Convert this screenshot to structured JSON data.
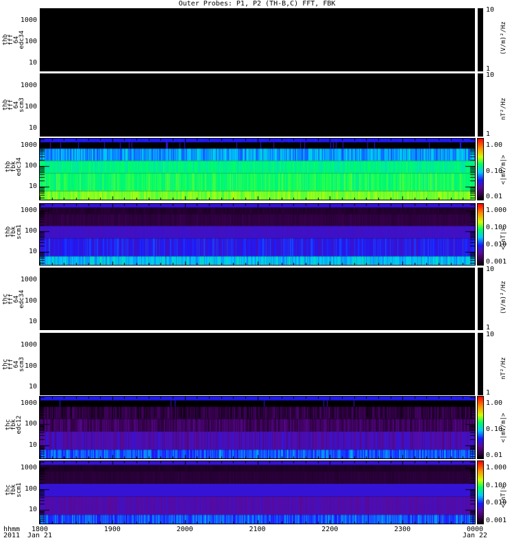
{
  "title": "Outer Probes: P1, P2 (TH-B,C) FFT, FBK",
  "x_axis": {
    "left_label_lines": [
      "hhmm",
      "2011"
    ],
    "ticks": [
      {
        "label": "1800",
        "sub": "Jan 21",
        "hour": 0
      },
      {
        "label": "1900",
        "sub": "",
        "hour": 1
      },
      {
        "label": "2000",
        "sub": "",
        "hour": 2
      },
      {
        "label": "2100",
        "sub": "",
        "hour": 3
      },
      {
        "label": "2200",
        "sub": "",
        "hour": 4
      },
      {
        "label": "2300",
        "sub": "",
        "hour": 5
      },
      {
        "label": "0000",
        "sub": "Jan 22",
        "hour": 6
      }
    ]
  },
  "chart_data": [
    {
      "type": "heatmap",
      "label": "thb\nfff\n64\nedc34",
      "kind": "fff",
      "ylim": [
        4,
        4000
      ],
      "yticks": [
        "10",
        "100",
        "1000"
      ],
      "cbar_ticks": [
        "10",
        "1"
      ],
      "cbar_unit": "(V/m)²/Hz",
      "bands": []
    },
    {
      "type": "heatmap",
      "label": "thb\nfff\n64\nscm3",
      "kind": "fff",
      "ylim": [
        4,
        4000
      ],
      "yticks": [
        "10",
        "100",
        "1000"
      ],
      "cbar_ticks": [
        "10",
        "1"
      ],
      "cbar_unit": "nT²/Hz",
      "bands": []
    },
    {
      "type": "heatmap",
      "label": "thb\nfbk\nedc34",
      "kind": "fbk",
      "ylim": [
        2.3,
        2150
      ],
      "yticks": [
        "10",
        "100",
        "1000"
      ],
      "cbar_ticks": [
        "1.00",
        "0.10",
        "0.01"
      ],
      "cbar_unit": "<|mV/m|>",
      "seed": 3,
      "bands": [
        {
          "f": [
            1400,
            2150
          ],
          "level": 0.31,
          "var": 0.02
        },
        {
          "f": [
            700,
            1400
          ],
          "level": 0.0,
          "var": 0.0,
          "spikes": 0.03
        },
        {
          "f": [
            180,
            700
          ],
          "level": 0.42,
          "var": 0.07
        },
        {
          "f": [
            45,
            180
          ],
          "level": 0.55,
          "var": 0.04
        },
        {
          "f": [
            6,
            45
          ],
          "level": 0.58,
          "var": 0.05
        },
        {
          "f": [
            2.3,
            6
          ],
          "level": 0.65,
          "var": 0.04
        }
      ]
    },
    {
      "type": "heatmap",
      "label": "thb\nfbk\nscm1",
      "kind": "fbk",
      "ylim": [
        2.3,
        2150
      ],
      "yticks": [
        "10",
        "100",
        "1000"
      ],
      "cbar_ticks": [
        "1.000",
        "0.100",
        "0.010",
        "0.001"
      ],
      "cbar_unit": "<|nT|>",
      "seed": 7,
      "bands": [
        {
          "f": [
            1400,
            2150
          ],
          "level": 0.27,
          "var": 0.0
        },
        {
          "f": [
            700,
            1400
          ],
          "level": 0.06,
          "var": 0.015
        },
        {
          "f": [
            180,
            700
          ],
          "level": 0.08,
          "var": 0.015
        },
        {
          "f": [
            45,
            180
          ],
          "level": 0.25,
          "var": 0.01
        },
        {
          "f": [
            6,
            45
          ],
          "level": 0.3,
          "var": 0.06
        },
        {
          "f": [
            2.3,
            6
          ],
          "level": 0.45,
          "var": 0.06
        }
      ]
    },
    {
      "type": "heatmap",
      "label": "thc\nfff\n64\nedc34",
      "kind": "fff",
      "ylim": [
        4,
        4000
      ],
      "yticks": [
        "10",
        "100",
        "1000"
      ],
      "cbar_ticks": [
        "10",
        "1"
      ],
      "cbar_unit": "(V/m)²/Hz",
      "bands": []
    },
    {
      "type": "heatmap",
      "label": "thc\nfff\n64\nscm3",
      "kind": "fff",
      "ylim": [
        4,
        4000
      ],
      "yticks": [
        "10",
        "100",
        "1000"
      ],
      "cbar_ticks": [
        "10",
        "1"
      ],
      "cbar_unit": "nT²/Hz",
      "bands": []
    },
    {
      "type": "heatmap",
      "label": "thc\nfbk\nedc12",
      "kind": "fbk",
      "ylim": [
        2.3,
        2150
      ],
      "yticks": [
        "10",
        "100",
        "1000"
      ],
      "cbar_ticks": [
        "1.00",
        "0.10",
        "0.01"
      ],
      "cbar_unit": "<|mV/m|>",
      "seed": 11,
      "bands": [
        {
          "f": [
            1400,
            2150
          ],
          "level": 0.31,
          "var": 0.0
        },
        {
          "f": [
            700,
            1400
          ],
          "level": 0.0,
          "var": 0.0,
          "spikes": 0.01
        },
        {
          "f": [
            180,
            700
          ],
          "level": 0.08,
          "var": 0.06
        },
        {
          "f": [
            45,
            180
          ],
          "level": 0.12,
          "var": 0.06
        },
        {
          "f": [
            6,
            45
          ],
          "level": 0.22,
          "var": 0.06
        },
        {
          "f": [
            2.3,
            6
          ],
          "level": 0.36,
          "var": 0.07
        }
      ]
    },
    {
      "type": "heatmap",
      "label": "thc\nfbk\nscm1",
      "kind": "fbk",
      "ylim": [
        2.3,
        2150
      ],
      "yticks": [
        "10",
        "100",
        "1000"
      ],
      "cbar_ticks": [
        "1.000",
        "0.100",
        "0.010",
        "0.001"
      ],
      "cbar_unit": "<|nT|>",
      "seed": 19,
      "bands": [
        {
          "f": [
            1400,
            2150
          ],
          "level": 0.27,
          "var": 0.0
        },
        {
          "f": [
            700,
            1400
          ],
          "level": 0.05,
          "var": 0.01
        },
        {
          "f": [
            180,
            700
          ],
          "level": 0.07,
          "var": 0.01
        },
        {
          "f": [
            45,
            180
          ],
          "level": 0.27,
          "var": 0.0
        },
        {
          "f": [
            6,
            45
          ],
          "level": 0.22,
          "var": 0.03
        },
        {
          "f": [
            2.3,
            6
          ],
          "level": 0.36,
          "var": 0.07
        }
      ]
    }
  ]
}
